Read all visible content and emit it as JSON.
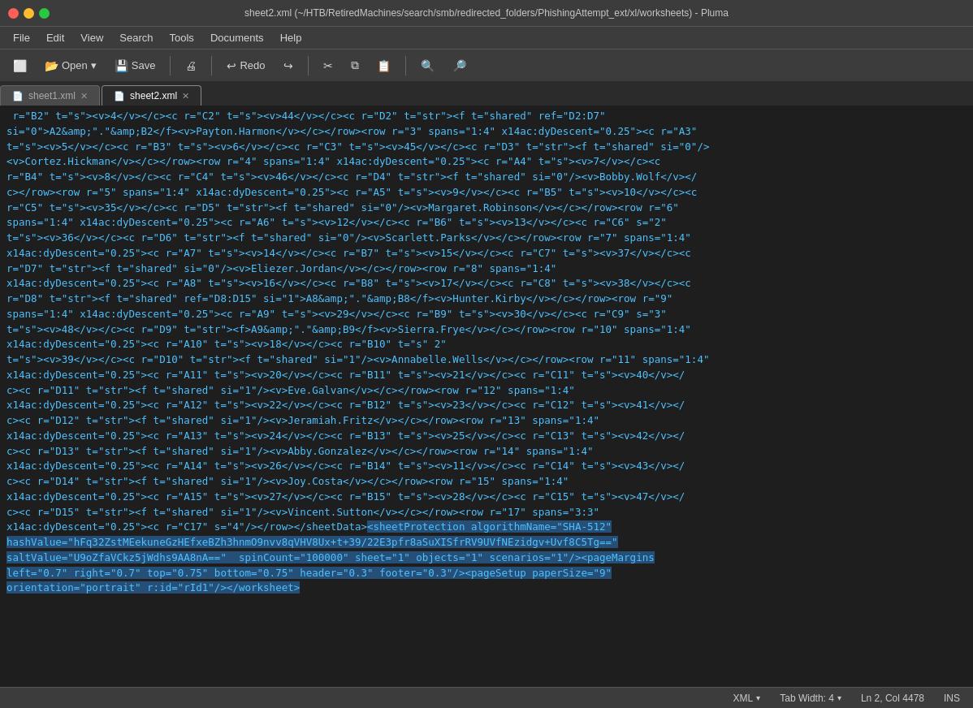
{
  "window": {
    "title": "sheet2.xml (~/HTB/RetiredMachines/search/smb/redirected_folders/PhishingAttempt_ext/xl/worksheets) - Pluma"
  },
  "menu": {
    "items": [
      "File",
      "Edit",
      "View",
      "Search",
      "Tools",
      "Documents",
      "Help"
    ]
  },
  "toolbar": {
    "buttons": [
      {
        "id": "new",
        "label": "New",
        "icon": "🗋"
      },
      {
        "id": "open",
        "label": "Open",
        "icon": "📂",
        "has_arrow": true
      },
      {
        "id": "save",
        "label": "Save",
        "icon": "💾"
      },
      {
        "id": "print",
        "label": "Print",
        "icon": "🖨"
      },
      {
        "id": "undo",
        "label": "Undo",
        "icon": "↩"
      },
      {
        "id": "redo",
        "label": "Redo",
        "icon": "↪"
      },
      {
        "id": "cut",
        "label": "Cut",
        "icon": "✂"
      },
      {
        "id": "copy",
        "label": "Copy",
        "icon": "⧉"
      },
      {
        "id": "paste",
        "label": "Paste",
        "icon": "📋"
      },
      {
        "id": "search",
        "label": "Search",
        "icon": "🔍"
      },
      {
        "id": "replace",
        "label": "Replace",
        "icon": "🔎"
      }
    ]
  },
  "tabs": [
    {
      "id": "sheet1",
      "label": "sheet1.xml",
      "active": false
    },
    {
      "id": "sheet2",
      "label": "sheet2.xml",
      "active": true
    }
  ],
  "editor": {
    "content": " r=\"B2\" t=\"s\"><v>4</v></c><c r=\"C2\" t=\"s\"><v>44</v></c><c r=\"D2\" t=\"str\"><f t=\"shared\" ref=\"D2:D7\" si=\"0\">A2&amp;\".\".&amp;B2</f><v>Payton.Harmon</v></c></row><row r=\"3\" spans=\"1:4\" x14ac:dyDescent=\"0.25\"><c r=\"A3\" t=\"s\"><v>5</v></c><c r=\"B3\" t=\"s\"><v>6</v></c><c r=\"C3\" t=\"s\"><v>45</v></c><c r=\"D3\" t=\"str\"><f t=\"shared\" si=\"0\"/><v>Cortez.Hickman</v></c></row><row r=\"4\" spans=\"1:4\" x14ac:dyDescent=\"0.25\"><c r=\"A4\" t=\"s\"><v>7</v></c><c r=\"B4\" t=\"s\"><v>8</v></c><c r=\"C4\" t=\"s\"><v>46</v></c><c r=\"D4\" t=\"str\"><f t=\"shared\" si=\"0\"/><v>Bobby.Wolf</v></c></row><row r=\"5\" spans=\"1:4\" x14ac:dyDescent=\"0.25\"><c r=\"A5\" t=\"s\"><v>9</v></c><c r=\"B5\" t=\"s\"><v>10</v></c><c r=\"C5\" t=\"s\"><v>35</v></c><c r=\"D5\" t=\"str\"><f t=\"shared\" si=\"0\"/><v>Margaret.Robinson</v></c></row><row r=\"6\" spans=\"1:4\" x14ac:dyDescent=\"0.25\"><c r=\"A6\" t=\"s\"><v>12</v></c><c r=\"B6\" t=\"s\"><v>13</v></c><c r=\"C6\" s=\"2\" t=\"s\"><v>36</v></c><c r=\"D6\" t=\"str\"><f t=\"shared\" si=\"0\"/><v>Scarlett.Parks</v></c></row><row r=\"7\" spans=\"1:4\" x14ac:dyDescent=\"0.25\"><c r=\"A7\" t=\"s\"><v>14</v></c><c r=\"B7\" t=\"s\"><v>15</v></c><c r=\"C7\" t=\"s\"><v>37</v></c><c r=\"D7\" t=\"str\"><f t=\"shared\" si=\"0\"/><v>Eliezer.Jordan</v></c></row><row r=\"8\" spans=\"1:4\" x14ac:dyDescent=\"0.25\"><c r=\"A8\" t=\"s\"><v>16</v></c><c r=\"B8\" t=\"s\"><v>17</v></c><c r=\"C8\" t=\"s\"><v>38</v></c><c r=\"D8\" t=\"str\"><f t=\"shared\" ref=\"D8:D15\" si=\"1\">A8&amp;\".\".&amp;B8</f><v>Hunter.Kirby</v></c></row><row r=\"9\" spans=\"1:4\" x14ac:dyDescent=\"0.25\"><c r=\"A9\" t=\"s\"><v>29</v></c><c r=\"B9\" t=\"s\"><v>30</v></c><c r=\"C9\" s=\"3\" t=\"s\"><v>48</v></c><c r=\"D9\" t=\"str\"><f>A9&amp;\".\"&amp;B9</f><v>Sierra.Frye</v></c></row><row r=\"10\" spans=\"1:4\" x14ac:dyDescent=\"0.25\"><c r=\"A10\" t=\"s\"><v>18</v></c><c r=\"B10\" t=\"s\"><v>2\" t=\"s\"><v>39</v></c><c r=\"D10\" t=\"str\"><f t=\"shared\" si=\"1\"/><v>Annabelle.Wells</v></c></row><row r=\"11\" spans=\"1:4\" x14ac:dyDescent=\"0.25\"><c r=\"A11\" t=\"s\"><v>20</v></c><c r=\"B11\" t=\"s\"><v>21</v></c><c r=\"C11\" t=\"s\"><v>40</v></c><c r=\"D11\" t=\"str\"><f t=\"shared\" si=\"1\"/><v>Eve.Galvan</v></c></row><row r=\"12\" spans=\"1:4\" x14ac:dyDescent=\"0.25\"><c r=\"A12\" t=\"s\"><v>22</v></c><c r=\"B12\" t=\"s\"><v>23</v></c><c r=\"C12\" t=\"s\"><v>41</v></c><c r=\"D12\" t=\"str\"><f t=\"shared\" si=\"1\"/><v>Jeramiah.Fritz</v></c></row><row r=\"13\" spans=\"1:4\" x14ac:dyDescent=\"0.25\"><c r=\"A13\" t=\"s\"><v>24</v></c><c r=\"B13\" t=\"s\"><v>25</v></c><c r=\"C13\" t=\"s\"><v>42</v></c><c r=\"D13\" t=\"str\"><f t=\"shared\" si=\"1\"/><v>Abby.Gonzalez</v></c></row><row r=\"14\" spans=\"1:4\" x14ac:dyDescent=\"0.25\"><c r=\"A14\" t=\"s\"><v>26</v></c><c r=\"B14\" t=\"s\"><v>11</v></c><c r=\"C14\" t=\"s\"><v>43</v></c><c r=\"D14\" t=\"str\"><f t=\"shared\" si=\"1\"/><v>Joy.Costa</v></c></row><row r=\"15\" spans=\"1:4\" x14ac:dyDescent=\"0.25\"><c r=\"A15\" t=\"s\"><v>27</v></c><c r=\"B15\" t=\"s\"><v>28</v></c><c r=\"C15\" t=\"s\"><v>47</v></c><c r=\"D15\" t=\"str\"><f t=\"shared\" si=\"1\"/><v>Vincent.Sutton</v></c></row><row r=\"17\" spans=\"3:3\" x14ac:dyDescent=\"0.25\"><c r=\"C17\" s=\"4\"/></row></sheetData>",
    "selected_content": "<sheetProtection algorithmName=\"SHA-512\" hashValue=\"hFq32ZstMEekuneGzHEfxeBZh3hnmO9nvv8qVHV8Ux+t+39/22E3pfr8aSuXISfrRV9UVfNEzidgv+Uvf8C5Tg==\" saltValue=\"U9oZfaVCkz5jWdhs9AA8nA==\" spinCount=\"100000\" sheet=\"1\" objects=\"1\" scenarios=\"1\"/><pageMargins left=\"0.7\" right=\"0.7\" top=\"0.75\" bottom=\"0.75\" header=\"0.3\" footer=\"0.3\"/><pageSetup paperSize=\"9\" orientation=\"portrait\" r:id=\"rId1\"/></worksheet>"
  },
  "status_bar": {
    "language": "XML",
    "tab_width": "Tab Width: 4",
    "position": "Ln 2, Col 4478",
    "mode": "INS"
  }
}
